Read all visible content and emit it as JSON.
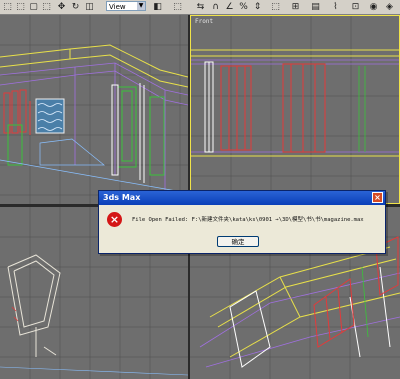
{
  "toolbar": {
    "view_combo": "View"
  },
  "viewports": {
    "top_right_label": "Front"
  },
  "dialog": {
    "title": "3ds Max",
    "close_glyph": "×",
    "icon": "error-icon",
    "message": "File Open Failed: F:\\新建文件夹\\kata\\ks\\0901 →\\3D\\模型\\书\\书\\magazine.max",
    "ok_label": "确定"
  },
  "colors": {
    "title_bar": "#0a3fb8",
    "active_viewport_border": "#f0e34a",
    "error_icon": "#d41616"
  }
}
